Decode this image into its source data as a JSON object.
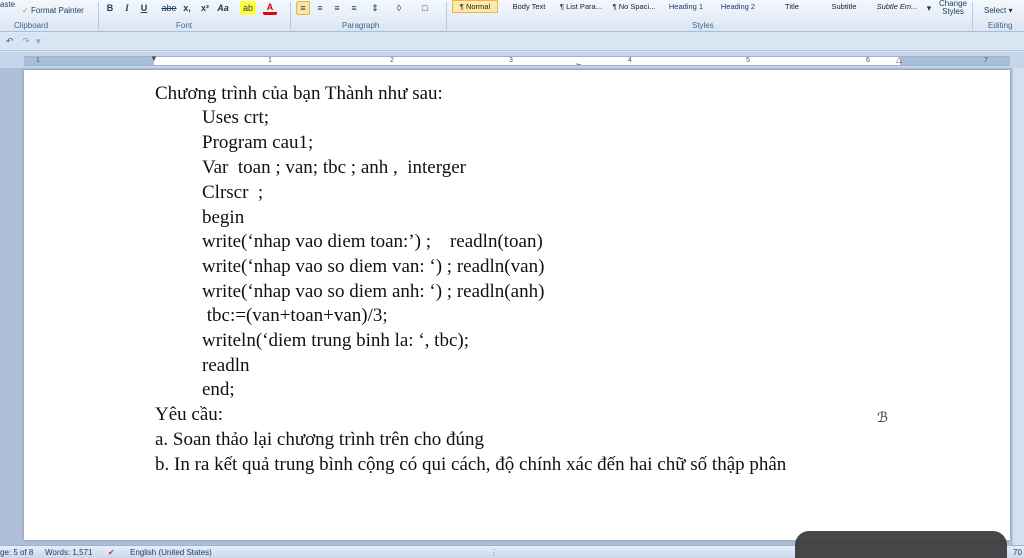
{
  "ribbon": {
    "clipboard": {
      "paste_label": "aste",
      "format_painter_label": "Format Painter"
    },
    "font": {
      "bold": "B",
      "italic": "I",
      "underline": "U",
      "strikethrough": "abe",
      "subscript": "x,",
      "superscript": "x²",
      "text_color": "A"
    },
    "styles": [
      {
        "label": "¶ Normal",
        "active": true
      },
      {
        "label": "Body Text",
        "active": false
      },
      {
        "label": "¶ List Para...",
        "active": false
      },
      {
        "label": "¶ No Spaci...",
        "active": false
      },
      {
        "label": "Heading 1",
        "active": false
      },
      {
        "label": "Heading 2",
        "active": false
      },
      {
        "label": "Title",
        "active": false
      },
      {
        "label": "Subtitle",
        "active": false
      },
      {
        "label": "Subtle Em...",
        "active": false
      }
    ],
    "change_styles_label": "Change Styles",
    "select_label": "Select",
    "group_labels": {
      "clipboard": "Clipboard",
      "font": "Font",
      "paragraph": "Paragraph",
      "styles": "Styles",
      "editing": "Editing"
    }
  },
  "ruler": {
    "numbers": [
      "1",
      "1",
      "2",
      "3",
      "4",
      "5",
      "6",
      "7"
    ]
  },
  "document": {
    "lines": [
      "Chương trình của bạn Thành như sau:",
      "Uses crt;",
      "Program cau1;",
      "Var  toan ; van; tbc ; anh ,  interger",
      "Clrscr  ;",
      "begin",
      "write(‘nhap vao diem toan:’) ;    readln(toan)",
      "write(‘nhap vao so diem van: ‘) ; readln(van)",
      "write(‘nhap vao so diem anh: ‘) ; readln(anh)",
      " tbc:=(van+toan+van)/3;",
      "writeln(‘diem trung binh la: ‘, tbc);",
      "readln",
      "end;",
      "Yêu cầu:",
      "a. Soan thảo lại chương trình trên cho đúng",
      "b. In ra kết quả trung bình cộng có qui cách, độ chính xác đến hai chữ số thập phân"
    ]
  },
  "status": {
    "page": "ge: 5 of 8",
    "words": "Words: 1,571",
    "language": "English (United States)",
    "zoom": "70"
  }
}
